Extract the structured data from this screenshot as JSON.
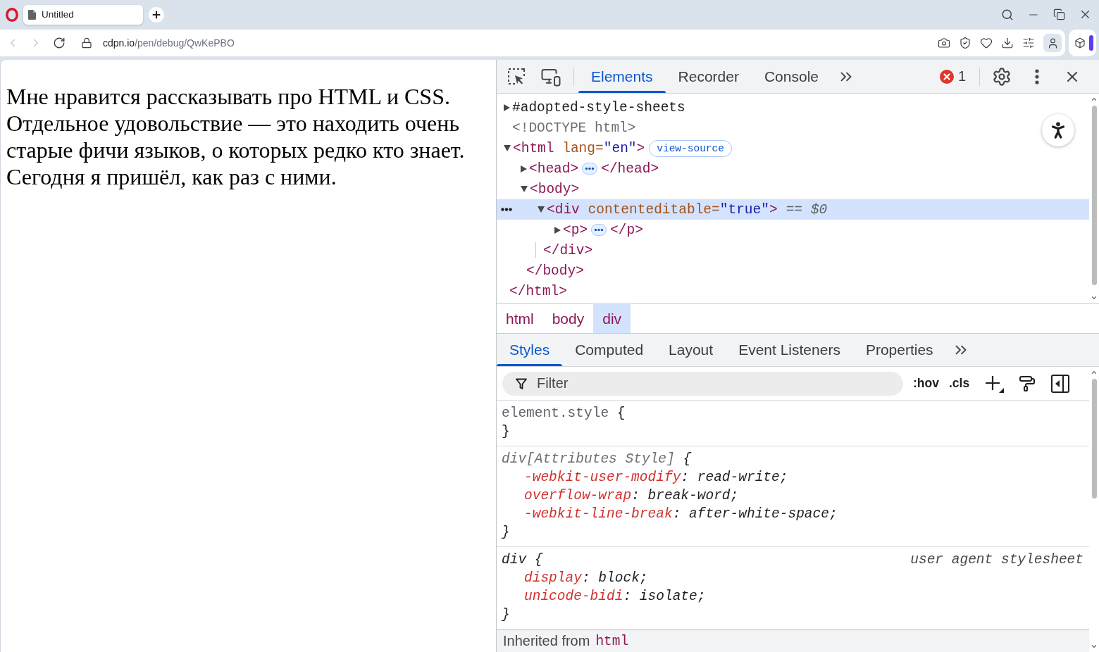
{
  "browser": {
    "tabs": [
      {
        "title": "Untitled",
        "selected": true
      }
    ],
    "navigation": [
      {
        "kind": "back",
        "disabled": true
      },
      {
        "kind": "forward",
        "disabled": true
      },
      {
        "kind": "reload",
        "disabled": false
      }
    ],
    "address": {
      "host": "cdpn.io",
      "path": "/pen/debug/QwKePBO"
    }
  },
  "page": {
    "paragraph": "Мне нравится рассказывать про HTML и CSS. Отдельное удовольствие — это находить очень старые фичи языков, о которых редко кто знает. Сегодня я пришёл, как раз с ними."
  },
  "devtools": {
    "tabs": [
      {
        "label": "Elements",
        "selected": true
      },
      {
        "label": "Recorder",
        "selected": false
      },
      {
        "label": "Console",
        "selected": false
      }
    ],
    "errors": "1",
    "dom_tree": [
      {
        "kind": "shadow",
        "label": "#adopted-style-sheets",
        "expanded": false,
        "selected": false
      },
      {
        "kind": "doctype",
        "label": "<!DOCTYPE html>",
        "selected": false
      },
      {
        "kind": "element",
        "open": "<html",
        "attributes": [
          {
            "name": "lang",
            "equals": "=",
            "value": "\"en\""
          }
        ],
        "open_end": ">",
        "badge": "view-source",
        "expanded": true,
        "selected": false,
        "children": [
          {
            "kind": "element",
            "open": "<head",
            "open_end": ">",
            "expanded": false,
            "selected": false,
            "close": "</head>"
          },
          {
            "kind": "element",
            "open": "<body",
            "open_end": ">",
            "expanded": true,
            "selected": false,
            "children": [
              {
                "kind": "element",
                "open": "<div",
                "attributes": [
                  {
                    "name": "contenteditable",
                    "equals": "=",
                    "value": "\"true\""
                  }
                ],
                "open_end": ">",
                "marker": "== $0",
                "expanded": true,
                "selected": true,
                "children": [
                  {
                    "kind": "element",
                    "open": "<p",
                    "open_end": ">",
                    "expanded": false,
                    "selected": false,
                    "close": "</p>"
                  }
                ],
                "close": "</div>"
              }
            ],
            "close": "</body>"
          }
        ],
        "close": "</html>"
      }
    ],
    "breadcrumbs": [
      {
        "label": "html",
        "selected": false
      },
      {
        "label": "body",
        "selected": false
      },
      {
        "label": "div",
        "selected": true
      }
    ],
    "sidebar_tabs": [
      {
        "label": "Styles",
        "selected": true
      },
      {
        "label": "Computed",
        "selected": false
      },
      {
        "label": "Layout",
        "selected": false
      },
      {
        "label": "Event Listeners",
        "selected": false
      },
      {
        "label": "Properties",
        "selected": false
      }
    ],
    "filter": {
      "placeholder": "Filter"
    },
    "style_toggles": [
      {
        "label": ":hov"
      },
      {
        "label": ".cls"
      }
    ],
    "rules": [
      {
        "kind": "inline",
        "selector": "element.style",
        "open": "{",
        "close": "}"
      },
      {
        "kind": "attributes",
        "selector": "div[Attributes Style]",
        "open": "{",
        "close": "}",
        "declarations": [
          {
            "property": "-webkit-user-modify",
            "separator": ": ",
            "value": "read-write;"
          },
          {
            "property": "overflow-wrap",
            "separator": ": ",
            "value": "break-word;"
          },
          {
            "property": "-webkit-line-break",
            "separator": ": ",
            "value": "after-white-space;"
          }
        ]
      },
      {
        "kind": "user-agent",
        "selector": "div",
        "open": "{",
        "close": "}",
        "source": "user agent stylesheet",
        "declarations": [
          {
            "property": "display",
            "separator": ": ",
            "value": "block;"
          },
          {
            "property": "unicode-bidi",
            "separator": ": ",
            "value": "isolate;"
          }
        ]
      }
    ],
    "inherited": {
      "label": "Inherited from",
      "element": "html"
    }
  }
}
